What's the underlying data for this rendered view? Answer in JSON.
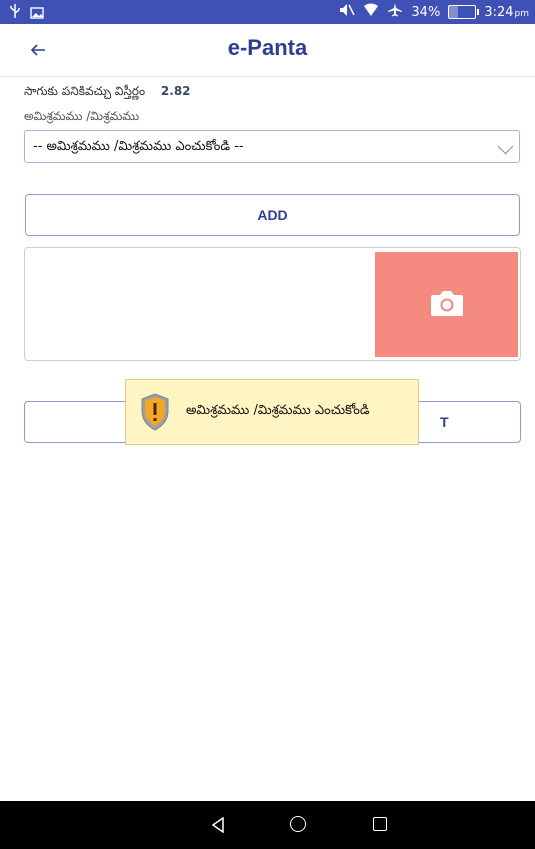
{
  "status_bar": {
    "battery_percent": "34%",
    "battery_level": 0.34,
    "time": "3:24",
    "time_suffix": "pm",
    "icons": [
      "usb-icon",
      "image-icon",
      "mute-icon",
      "wifi-icon",
      "airplane-icon",
      "battery-charging-icon"
    ]
  },
  "appbar": {
    "title": "e-Panta",
    "back_icon": "arrow-left-icon"
  },
  "form": {
    "area_label": "సాగుకు పనికివచ్చు విస్తీర్ణం",
    "area_value": "2.82",
    "mix_label": "అమిశ్రమము /మిశ్రమము",
    "mix_select_value": "-- అమిశ్రమము /మిశ్రమము ఎంచుకోండి --",
    "add_label": "ADD",
    "camera_icon": "camera-icon",
    "submit_label_visible": "T"
  },
  "toast": {
    "message": "అమిశ్రమము /మిశ్రమము ఎంచుకోండి",
    "icon": "warning-shield-icon"
  },
  "nav_bar": {
    "icons": [
      "nav-back-icon",
      "nav-home-icon",
      "nav-recents-icon"
    ]
  },
  "colors": {
    "primary": "#3f51b5",
    "title": "#2f3f8f",
    "camera_tile": "#f48a80",
    "toast_bg": "#fff5c2"
  }
}
